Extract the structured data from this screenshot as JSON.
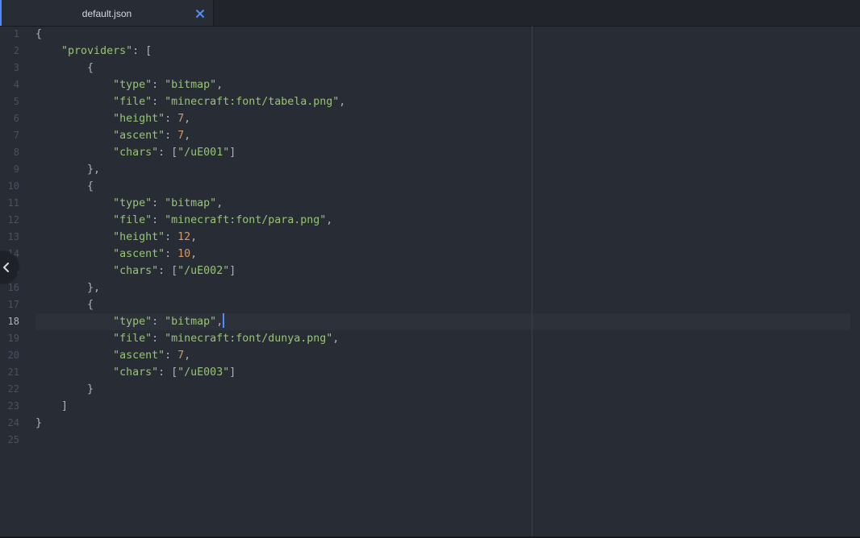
{
  "tab": {
    "title": "default.json",
    "close_icon": "close-icon",
    "accent_color": "#568af2"
  },
  "editor": {
    "active_line": 18,
    "line_numbers": [
      "1",
      "2",
      "3",
      "4",
      "5",
      "6",
      "7",
      "8",
      "9",
      "10",
      "11",
      "12",
      "13",
      "14",
      "15",
      "16",
      "17",
      "18",
      "19",
      "20",
      "21",
      "22",
      "23",
      "24",
      "25"
    ],
    "lines": [
      [
        {
          "t": "p",
          "v": "{"
        }
      ],
      [
        {
          "t": "p",
          "v": "    "
        },
        {
          "t": "s",
          "v": "\"providers\""
        },
        {
          "t": "p",
          "v": ": ["
        }
      ],
      [
        {
          "t": "p",
          "v": "        {"
        }
      ],
      [
        {
          "t": "p",
          "v": "            "
        },
        {
          "t": "s",
          "v": "\"type\""
        },
        {
          "t": "p",
          "v": ": "
        },
        {
          "t": "s",
          "v": "\"bitmap\""
        },
        {
          "t": "p",
          "v": ","
        }
      ],
      [
        {
          "t": "p",
          "v": "            "
        },
        {
          "t": "s",
          "v": "\"file\""
        },
        {
          "t": "p",
          "v": ": "
        },
        {
          "t": "s",
          "v": "\"minecraft:font/tabela.png\""
        },
        {
          "t": "p",
          "v": ","
        }
      ],
      [
        {
          "t": "p",
          "v": "            "
        },
        {
          "t": "s",
          "v": "\"height\""
        },
        {
          "t": "p",
          "v": ": "
        },
        {
          "t": "n",
          "v": "7"
        },
        {
          "t": "p",
          "v": ","
        }
      ],
      [
        {
          "t": "p",
          "v": "            "
        },
        {
          "t": "s",
          "v": "\"ascent\""
        },
        {
          "t": "p",
          "v": ": "
        },
        {
          "t": "n",
          "v": "7"
        },
        {
          "t": "p",
          "v": ","
        }
      ],
      [
        {
          "t": "p",
          "v": "            "
        },
        {
          "t": "s",
          "v": "\"chars\""
        },
        {
          "t": "p",
          "v": ": ["
        },
        {
          "t": "s",
          "v": "\"/uE001\""
        },
        {
          "t": "p",
          "v": "]"
        }
      ],
      [
        {
          "t": "p",
          "v": "        },"
        }
      ],
      [
        {
          "t": "p",
          "v": "        {"
        }
      ],
      [
        {
          "t": "p",
          "v": "            "
        },
        {
          "t": "s",
          "v": "\"type\""
        },
        {
          "t": "p",
          "v": ": "
        },
        {
          "t": "s",
          "v": "\"bitmap\""
        },
        {
          "t": "p",
          "v": ","
        }
      ],
      [
        {
          "t": "p",
          "v": "            "
        },
        {
          "t": "s",
          "v": "\"file\""
        },
        {
          "t": "p",
          "v": ": "
        },
        {
          "t": "s",
          "v": "\"minecraft:font/para.png\""
        },
        {
          "t": "p",
          "v": ","
        }
      ],
      [
        {
          "t": "p",
          "v": "            "
        },
        {
          "t": "s",
          "v": "\"height\""
        },
        {
          "t": "p",
          "v": ": "
        },
        {
          "t": "n",
          "v": "12"
        },
        {
          "t": "p",
          "v": ","
        }
      ],
      [
        {
          "t": "p",
          "v": "            "
        },
        {
          "t": "s",
          "v": "\"ascent\""
        },
        {
          "t": "p",
          "v": ": "
        },
        {
          "t": "n",
          "v": "10"
        },
        {
          "t": "p",
          "v": ","
        }
      ],
      [
        {
          "t": "p",
          "v": "            "
        },
        {
          "t": "s",
          "v": "\"chars\""
        },
        {
          "t": "p",
          "v": ": ["
        },
        {
          "t": "s",
          "v": "\"/uE002\""
        },
        {
          "t": "p",
          "v": "]"
        }
      ],
      [
        {
          "t": "p",
          "v": "        },"
        }
      ],
      [
        {
          "t": "p",
          "v": "        {"
        }
      ],
      [
        {
          "t": "p",
          "v": "            "
        },
        {
          "t": "s",
          "v": "\"type\""
        },
        {
          "t": "p",
          "v": ": "
        },
        {
          "t": "s",
          "v": "\"bitmap\""
        },
        {
          "t": "p",
          "v": ","
        }
      ],
      [
        {
          "t": "p",
          "v": "            "
        },
        {
          "t": "s",
          "v": "\"file\""
        },
        {
          "t": "p",
          "v": ": "
        },
        {
          "t": "s",
          "v": "\"minecraft:font/dunya.png\""
        },
        {
          "t": "p",
          "v": ","
        }
      ],
      [
        {
          "t": "p",
          "v": "            "
        },
        {
          "t": "s",
          "v": "\"ascent\""
        },
        {
          "t": "p",
          "v": ": "
        },
        {
          "t": "n",
          "v": "7"
        },
        {
          "t": "p",
          "v": ","
        }
      ],
      [
        {
          "t": "p",
          "v": "            "
        },
        {
          "t": "s",
          "v": "\"chars\""
        },
        {
          "t": "p",
          "v": ": ["
        },
        {
          "t": "s",
          "v": "\"/uE003\""
        },
        {
          "t": "p",
          "v": "]"
        }
      ],
      [
        {
          "t": "p",
          "v": "        }"
        }
      ],
      [
        {
          "t": "p",
          "v": "    ]"
        }
      ],
      [
        {
          "t": "p",
          "v": "}"
        }
      ],
      []
    ]
  },
  "colors": {
    "background": "#282c34",
    "string": "#98c379",
    "number": "#d19a66",
    "punctuation": "#abb2bf",
    "line_number": "#495162",
    "cursor": "#528bff"
  },
  "collapse_icon": "chevron-left-icon"
}
